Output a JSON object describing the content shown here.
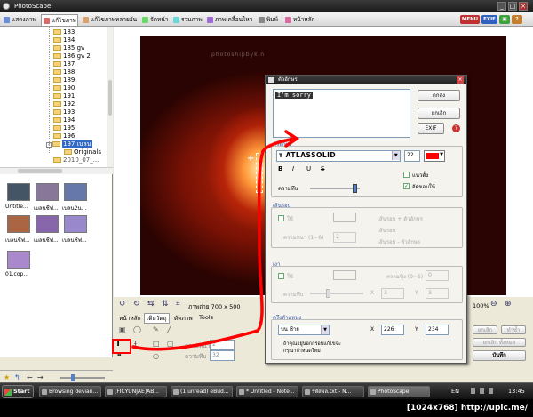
{
  "window": {
    "title": "PhotoScape"
  },
  "tabs": [
    {
      "label": "แสดงภาพ",
      "color": "#6a8ed8"
    },
    {
      "label": "แก้ไขภาพ",
      "color": "#d86a6a",
      "active": true
    },
    {
      "label": "แก้ไขภาพหลายอัน",
      "color": "#d8a06a"
    },
    {
      "label": "จัดหน้า",
      "color": "#6ad86a"
    },
    {
      "label": "รวมภาพ",
      "color": "#6ad8d8"
    },
    {
      "label": "ภาพเคลื่อนไหว",
      "color": "#a06ad8"
    },
    {
      "label": "พิมพ์",
      "color": "#888888"
    },
    {
      "label": "หน้าหลัก",
      "color": "#d86aa0"
    }
  ],
  "right_buttons": {
    "menu": "MENU",
    "exif": "EXIF"
  },
  "tree": {
    "items": [
      "183",
      "184",
      "185 gv",
      "186 gv 2",
      "187",
      "188",
      "189",
      "190",
      "191",
      "192",
      "193",
      "194",
      "195",
      "196",
      "197 เบลน"
    ],
    "sub_item": "Originals",
    "partial": "2010_07_..."
  },
  "thumbnails": [
    {
      "label": "Untitle...",
      "color": "#445566"
    },
    {
      "label": "เบลนชีฟ...",
      "color": "#887799"
    },
    {
      "label": "เบลน2น...",
      "color": "#6677aa"
    },
    {
      "label": "เบลนชีฟ...",
      "color": "#aa6644"
    },
    {
      "label": "เบลนชีฟ...",
      "color": "#8866aa"
    },
    {
      "label": "เบลนชีฟ...",
      "color": "#9988cc"
    },
    {
      "label": "01.cop...",
      "color": "#aa88cc"
    }
  ],
  "photo": {
    "watermark": "photoshipbykin"
  },
  "canvas_info": {
    "size_label": "ภาพถ่าย 700 x 500",
    "zoom": "100%"
  },
  "bottom_tabs": [
    "หน้าหลัก",
    "เติมวัตถุ",
    "ตัดภาพ",
    "Tools"
  ],
  "bottom_fields": {
    "width_label": "ความหนา",
    "width_value": "2",
    "opacity_label": "ความทึบ",
    "opacity_value": "32"
  },
  "right_actions": {
    "undo": "ยกเลิก",
    "redo": "ทำซ้ำ",
    "undo_all": "ยกเลิก ทั้งหมด",
    "save": "บันทึก"
  },
  "dialog": {
    "title": "ตัวอักษร",
    "text_value": "I'm sorry",
    "ok": "ตกลง",
    "cancel": "ยกเลิก",
    "exif": "EXIF",
    "font_section": "ตัวอักษร",
    "font_name": "ATLASSOLID",
    "font_size": "22",
    "text_color": "#ff0000",
    "style_buttons": [
      "B",
      "I",
      "U",
      "S"
    ],
    "shadow_label": "แนวตั้ง",
    "antialias_label": "จัดขอบให้",
    "opacity_label": "ความทึบ",
    "outline_section": "เส้นรอบ",
    "outline_use": "ใช้",
    "outline_thickness_label": "ความหนา (1~6)",
    "outline_thickness": "2",
    "outline_opt1": "เส้นรอบ + ตัวอักษร",
    "outline_opt2": "เส้นรอบ",
    "outline_opt3": "เส้นรอบ - ตัวอักษร",
    "shadow_section": "เงา",
    "shadow_use": "ใช้",
    "shadow_soft_label": "ความฟุ้ง (0~5)",
    "shadow_soft": "0",
    "shadow_x": "3",
    "shadow_y": "3",
    "shadow_opacity_label": "ความทึบ",
    "position_section": "ตรึงตำแหน่ง",
    "position_value": "บน ซ้าย",
    "pos_x": "226",
    "pos_y": "234",
    "note_line1": "ถ้าคุณอยู่นอกกรอบแก้ไขจะ",
    "note_line2": "กรุณากำหนดใหม่"
  },
  "taskbar": {
    "start": "Start",
    "items": [
      "Browsing devian...",
      "[FICYUNJAE]AB...",
      "(1 unread) eBud...",
      "* Untitled - Note...",
      "รหัสผล.txt - N...",
      "PhotoScape"
    ],
    "lang": "EN",
    "clock": "13:45"
  },
  "footer": {
    "text": "[1024x768] http://upic.me/"
  }
}
